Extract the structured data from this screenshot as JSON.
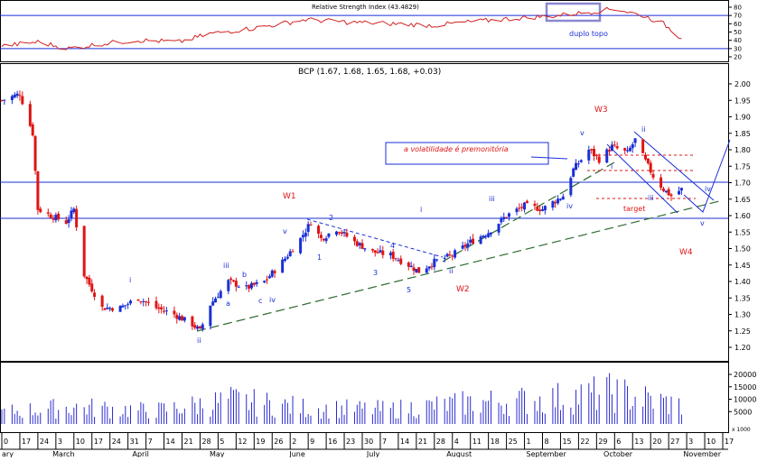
{
  "rsi_panel": {
    "title": "Relative Strength Index (43.4829)",
    "y_ticks": [
      "80",
      "70",
      "60",
      "50",
      "40",
      "30",
      "20"
    ],
    "annotation": "duplo topo",
    "levels": [
      70,
      30
    ],
    "ylim": [
      15,
      85
    ]
  },
  "price_panel": {
    "title": "BCP (1.67, 1.68, 1.65, 1.68, +0.03)",
    "y_ticks": [
      "2.00",
      "1.95",
      "1.90",
      "1.85",
      "1.80",
      "1.75",
      "1.70",
      "1.65",
      "1.60",
      "1.55",
      "1.50",
      "1.45",
      "1.40",
      "1.35",
      "1.30",
      "1.25",
      "1.20"
    ],
    "note_box": "a volatilidade é premonitória",
    "target_label": "target",
    "wave_labels_red": [
      "W1",
      "W2",
      "W3",
      "W4"
    ],
    "wave_labels_blue": [
      "i",
      "ii",
      "iii",
      "iv",
      "v",
      "1",
      "2",
      "3",
      "4",
      "5",
      "a",
      "b",
      "c"
    ],
    "horizontal_levels": [
      1.7,
      1.59
    ]
  },
  "volume_panel": {
    "y_ticks": [
      "20000",
      "15000",
      "10000",
      "5000"
    ],
    "unit_label": "x 1000"
  },
  "x_axis": {
    "day_ticks": [
      "0",
      "17",
      "24",
      "3",
      "10",
      "17",
      "24",
      "31",
      "7",
      "14",
      "21",
      "28",
      "5",
      "12",
      "19",
      "26",
      "2",
      "9",
      "16",
      "23",
      "30",
      "7",
      "14",
      "21",
      "28",
      "4",
      "11",
      "18",
      "25",
      "1",
      "8",
      "15",
      "22",
      "29",
      "6",
      "13",
      "20",
      "27",
      "3",
      "10",
      "17"
    ],
    "month_labels": [
      "ary",
      "March",
      "April",
      "May",
      "June",
      "July",
      "August",
      "September",
      "October",
      "November"
    ]
  },
  "colors": {
    "up": "#1a2fd6",
    "down": "#e01414",
    "rsi_line": "#d42020",
    "level_line": "#1a2fd6",
    "trend_green": "#2d6a2d",
    "volume": "#2a2ad0",
    "annotation_box": "#8a88d0"
  },
  "chart_data": {
    "type": "candlestick",
    "title": "BCP (1.67, 1.68, 1.65, 1.68, +0.03)",
    "x_range": [
      "2011-02-10",
      "2011-11-17"
    ],
    "ylim": [
      1.17,
      2.03
    ],
    "price_anchors": [
      [
        "2011-02-10",
        1.95
      ],
      [
        "2011-02-17",
        1.97
      ],
      [
        "2011-02-22",
        1.85
      ],
      [
        "2011-02-24",
        1.62
      ],
      [
        "2011-03-01",
        1.6
      ],
      [
        "2011-03-07",
        1.58
      ],
      [
        "2011-03-10",
        1.62
      ],
      [
        "2011-03-14",
        1.42
      ],
      [
        "2011-03-21",
        1.32
      ],
      [
        "2011-03-28",
        1.32
      ],
      [
        "2011-04-04",
        1.35
      ],
      [
        "2011-04-11",
        1.32
      ],
      [
        "2011-04-18",
        1.3
      ],
      [
        "2011-04-25",
        1.27
      ],
      [
        "2011-04-28",
        1.25
      ],
      [
        "2011-05-02",
        1.33
      ],
      [
        "2011-05-09",
        1.4
      ],
      [
        "2011-05-16",
        1.38
      ],
      [
        "2011-05-23",
        1.4
      ],
      [
        "2011-05-30",
        1.46
      ],
      [
        "2011-06-06",
        1.53
      ],
      [
        "2011-06-10",
        1.58
      ],
      [
        "2011-06-14",
        1.53
      ],
      [
        "2011-06-20",
        1.56
      ],
      [
        "2011-06-27",
        1.52
      ],
      [
        "2011-07-04",
        1.49
      ],
      [
        "2011-07-11",
        1.48
      ],
      [
        "2011-07-18",
        1.45
      ],
      [
        "2011-07-22",
        1.43
      ],
      [
        "2011-07-28",
        1.46
      ],
      [
        "2011-08-04",
        1.48
      ],
      [
        "2011-08-11",
        1.52
      ],
      [
        "2011-08-18",
        1.55
      ],
      [
        "2011-08-25",
        1.6
      ],
      [
        "2011-09-01",
        1.63
      ],
      [
        "2011-09-08",
        1.62
      ],
      [
        "2011-09-12",
        1.64
      ],
      [
        "2011-09-16",
        1.66
      ],
      [
        "2011-09-20",
        1.74
      ],
      [
        "2011-09-26",
        1.8
      ],
      [
        "2011-09-30",
        1.77
      ],
      [
        "2011-10-05",
        1.81
      ],
      [
        "2011-10-11",
        1.79
      ],
      [
        "2011-10-14",
        1.83
      ],
      [
        "2011-10-17",
        1.78
      ],
      [
        "2011-10-21",
        1.72
      ],
      [
        "2011-10-25",
        1.68
      ],
      [
        "2011-10-28",
        1.66
      ],
      [
        "2011-11-01",
        1.68
      ]
    ],
    "rsi_anchors": [
      [
        "2011-02-10",
        33
      ],
      [
        "2011-02-24",
        38
      ],
      [
        "2011-03-08",
        30
      ],
      [
        "2011-03-21",
        36
      ],
      [
        "2011-04-04",
        40
      ],
      [
        "2011-04-20",
        38
      ],
      [
        "2011-05-02",
        48
      ],
      [
        "2011-05-20",
        55
      ],
      [
        "2011-06-08",
        65
      ],
      [
        "2011-06-24",
        62
      ],
      [
        "2011-07-12",
        60
      ],
      [
        "2011-07-28",
        58
      ],
      [
        "2011-08-10",
        62
      ],
      [
        "2011-08-26",
        66
      ],
      [
        "2011-09-14",
        70
      ],
      [
        "2011-09-26",
        74
      ],
      [
        "2011-10-06",
        78
      ],
      [
        "2011-10-17",
        70
      ],
      [
        "2011-10-25",
        60
      ],
      [
        "2011-10-31",
        45
      ],
      [
        "2011-11-03",
        42
      ]
    ],
    "volume_anchors": [
      [
        "2011-02-10",
        4500
      ],
      [
        "2011-03-10",
        6500
      ],
      [
        "2011-04-10",
        5000
      ],
      [
        "2011-05-10",
        9000
      ],
      [
        "2011-06-10",
        6000
      ],
      [
        "2011-07-10",
        5500
      ],
      [
        "2011-08-10",
        8000
      ],
      [
        "2011-09-10",
        9500
      ],
      [
        "2011-10-05",
        12000
      ],
      [
        "2011-11-01",
        7000
      ]
    ]
  }
}
